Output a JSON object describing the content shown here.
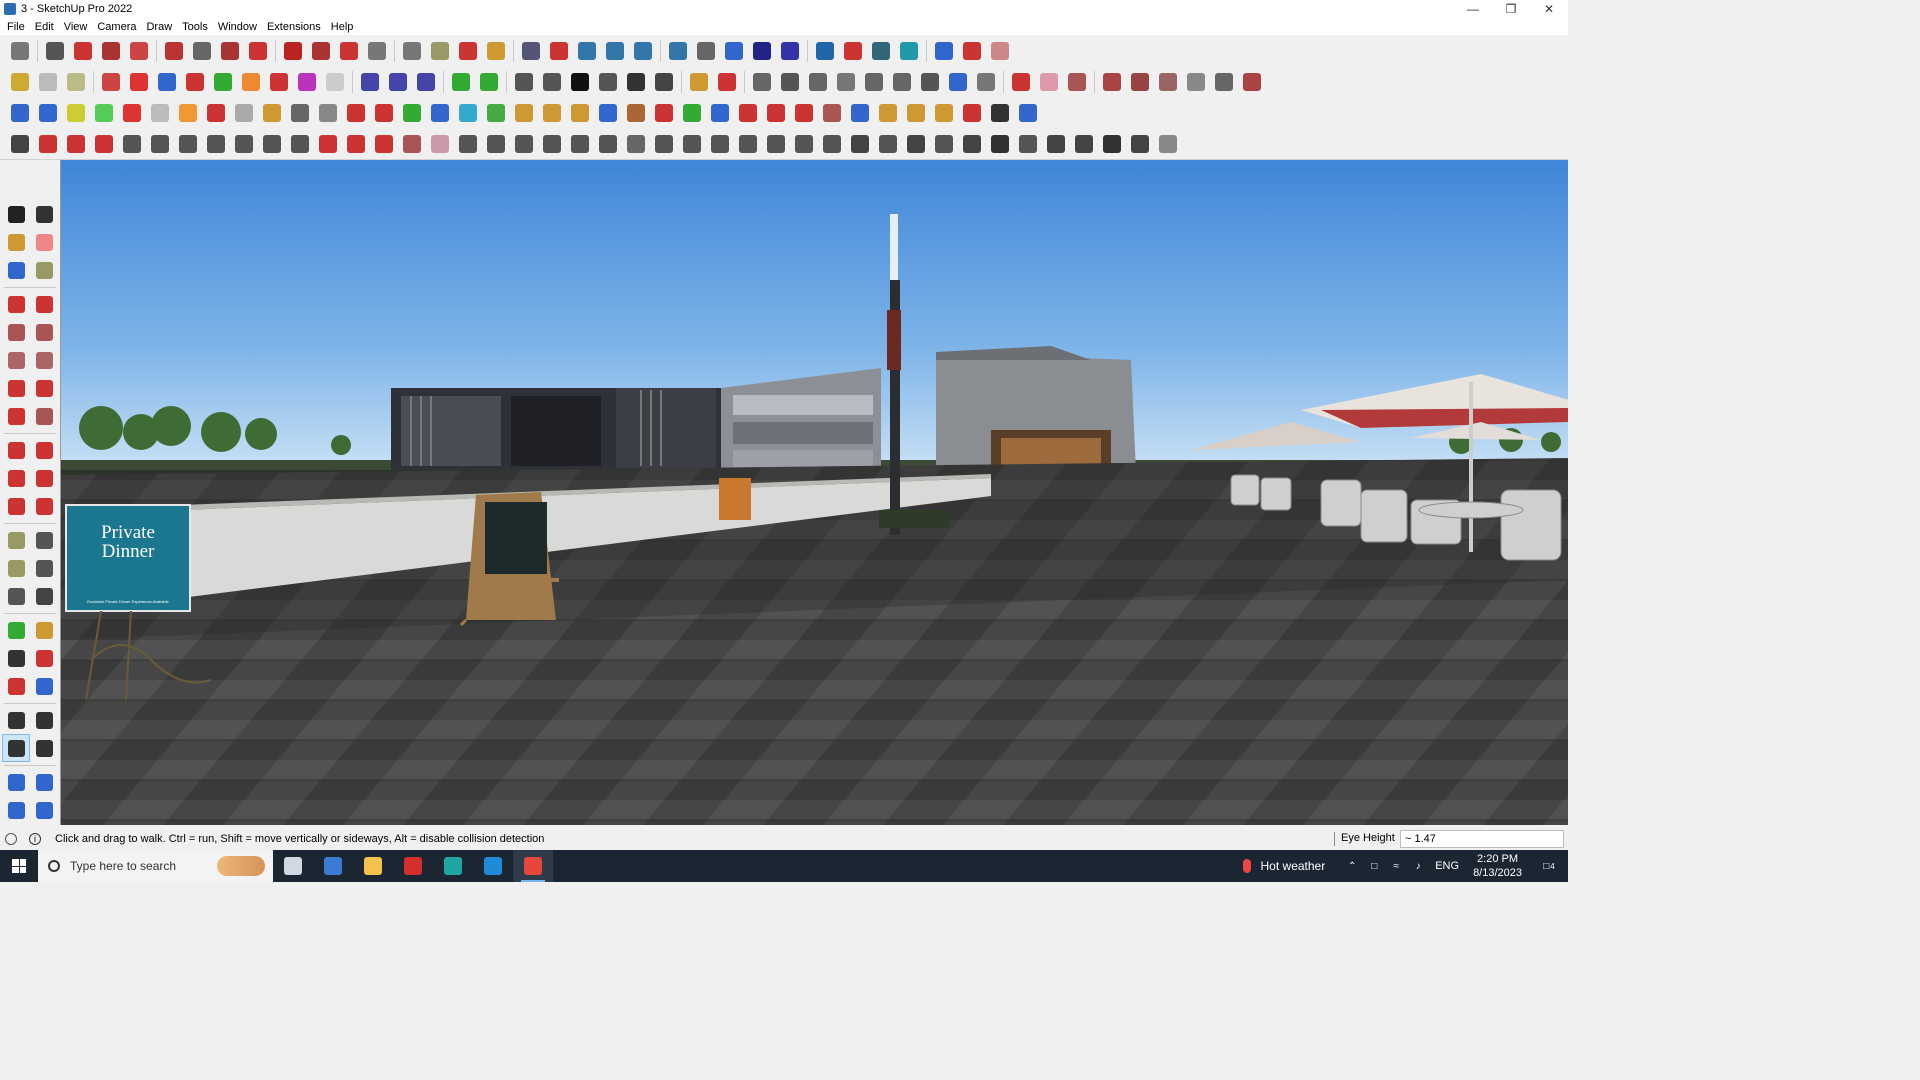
{
  "window": {
    "title": "3 - SketchUp Pro 2022",
    "controls": [
      "minimize-icon",
      "maximize-icon",
      "close-icon"
    ]
  },
  "menu": [
    "File",
    "Edit",
    "View",
    "Camera",
    "Draw",
    "Tools",
    "Window",
    "Extensions",
    "Help"
  ],
  "toolbar_colors": {
    "row1": [
      "#777",
      "#555",
      "#c33",
      "#a33",
      "#c44",
      "#b33",
      "#666",
      "#a33",
      "#c33",
      "#b22",
      "#a33",
      "#c33",
      "#777",
      "#777",
      "#996",
      "#c33",
      "#c93",
      "#557",
      "#c33",
      "#37a",
      "#37a",
      "#37a",
      "#37a",
      "#666",
      "#36c",
      "#228",
      "#33a",
      "#26a",
      "#c33",
      "#367",
      "#29a",
      "#36c",
      "#c33",
      "#c88"
    ],
    "row2": [
      "#ca3",
      "#bbb",
      "#bb8",
      "#c44",
      "#d33",
      "#36c",
      "#c33",
      "#3a3",
      "#e83",
      "#c33",
      "#b3b",
      "#ccc",
      "#44a",
      "#44a",
      "#44a",
      "#3a3",
      "#3a3",
      "#555",
      "#555",
      "#111",
      "#555",
      "#333",
      "#444",
      "#c93",
      "#c33",
      "#666",
      "#555",
      "#666",
      "#777",
      "#666",
      "#666",
      "#555",
      "#36c",
      "#777",
      "#c33",
      "#d9a",
      "#a55",
      "#a44",
      "#944",
      "#966",
      "#888",
      "#666",
      "#a44"
    ],
    "row3": [
      "#36c",
      "#36c",
      "#cc3",
      "#5c5",
      "#d33",
      "#bbb",
      "#e93",
      "#c33",
      "#aaa",
      "#c93",
      "#666",
      "#888",
      "#c33",
      "#c33",
      "#3a3",
      "#36c",
      "#3ac",
      "#4a4",
      "#c93",
      "#c93",
      "#c93",
      "#36c",
      "#a63",
      "#c33",
      "#3a3",
      "#36c",
      "#c33",
      "#c33",
      "#c33",
      "#a55",
      "#36c",
      "#c93",
      "#c93",
      "#c93",
      "#c33",
      "#333",
      "#36c"
    ],
    "row4": [
      "#444",
      "#c33",
      "#c33",
      "#c33",
      "#555",
      "#555",
      "#555",
      "#555",
      "#555",
      "#555",
      "#555",
      "#c33",
      "#c33",
      "#c33",
      "#a55",
      "#c9a",
      "#555",
      "#555",
      "#555",
      "#555",
      "#555",
      "#555",
      "#666",
      "#555",
      "#555",
      "#555",
      "#555",
      "#555",
      "#555",
      "#555",
      "#444",
      "#555",
      "#444",
      "#555",
      "#444",
      "#333",
      "#555",
      "#444",
      "#444",
      "#333",
      "#444",
      "#888"
    ]
  },
  "left_tools": [
    {
      "name": "select-icon",
      "color": "#222"
    },
    {
      "name": "orbit-icon",
      "color": "#333"
    },
    {
      "name": "paint-bucket-icon",
      "color": "#c93"
    },
    {
      "name": "eraser-icon",
      "color": "#e88"
    },
    {
      "name": "make-component-icon",
      "color": "#36c"
    },
    {
      "name": "tape-measure-icon",
      "color": "#996"
    },
    {
      "name": "line-icon",
      "color": "#c33"
    },
    {
      "name": "freehand-icon",
      "color": "#c33"
    },
    {
      "name": "rectangle-icon",
      "color": "#a55"
    },
    {
      "name": "rotated-rectangle-icon",
      "color": "#a55"
    },
    {
      "name": "circle-icon",
      "color": "#a66"
    },
    {
      "name": "polygon-icon",
      "color": "#a66"
    },
    {
      "name": "arc-icon",
      "color": "#c33"
    },
    {
      "name": "pie-icon",
      "color": "#c33"
    },
    {
      "name": "three-point-arc-icon",
      "color": "#c33"
    },
    {
      "name": "two-point-arc-icon",
      "color": "#a55"
    },
    {
      "name": "move-icon",
      "color": "#c33"
    },
    {
      "name": "push-pull-icon",
      "color": "#c33"
    },
    {
      "name": "rotate-icon",
      "color": "#c33"
    },
    {
      "name": "follow-me-icon",
      "color": "#c33"
    },
    {
      "name": "scale-icon",
      "color": "#c33"
    },
    {
      "name": "offset-icon",
      "color": "#c33"
    },
    {
      "name": "tape-icon",
      "color": "#996"
    },
    {
      "name": "dimension-icon",
      "color": "#555"
    },
    {
      "name": "protractor-icon",
      "color": "#996"
    },
    {
      "name": "text-icon",
      "color": "#555"
    },
    {
      "name": "axes-icon",
      "color": "#555"
    },
    {
      "name": "3d-text-icon",
      "color": "#444"
    },
    {
      "name": "pan-orbit-icon",
      "color": "#3a3"
    },
    {
      "name": "pan-icon",
      "color": "#c93"
    },
    {
      "name": "zoom-icon",
      "color": "#333"
    },
    {
      "name": "zoom-window-icon",
      "color": "#c33"
    },
    {
      "name": "zoom-extents-icon",
      "color": "#c33"
    },
    {
      "name": "previous-view-icon",
      "color": "#36c"
    },
    {
      "name": "position-camera-icon",
      "color": "#333"
    },
    {
      "name": "look-around-icon",
      "color": "#333"
    },
    {
      "name": "walk-icon",
      "color": "#333"
    },
    {
      "name": "section-plane-icon",
      "color": "#333"
    },
    {
      "name": "outliner-icon",
      "color": "#36c"
    },
    {
      "name": "section-fill-icon",
      "color": "#36c"
    },
    {
      "name": "layers-icon",
      "color": "#36c"
    },
    {
      "name": "styles-icon",
      "color": "#36c"
    }
  ],
  "scene": {
    "sign_text_line1": "Private",
    "sign_text_line2": "Dinner",
    "sign_subtext": "Exclusive Private Dinner Experience Available"
  },
  "status": {
    "hint": "Click and drag to walk.  Ctrl = run, Shift = move vertically or sideways, Alt = disable collision detection",
    "vcb_label": "Eye Height",
    "vcb_value": "~ 1.47"
  },
  "taskbar": {
    "search_placeholder": "Type here to search",
    "apps": [
      {
        "name": "task-view-icon",
        "color": "#cfd8e3"
      },
      {
        "name": "calculator-icon",
        "color": "#3b7bd1"
      },
      {
        "name": "file-explorer-icon",
        "color": "#f2c14e"
      },
      {
        "name": "acrobat-icon",
        "color": "#d32f2f"
      },
      {
        "name": "3dsmax-icon",
        "color": "#1fa6a0"
      },
      {
        "name": "edge-icon",
        "color": "#1f8ad8"
      },
      {
        "name": "sketchup-icon",
        "color": "#e5483a"
      }
    ],
    "weather": "Hot weather",
    "lang": "ENG",
    "time": "2:20 PM",
    "date": "8/13/2023",
    "notifications": "4"
  }
}
